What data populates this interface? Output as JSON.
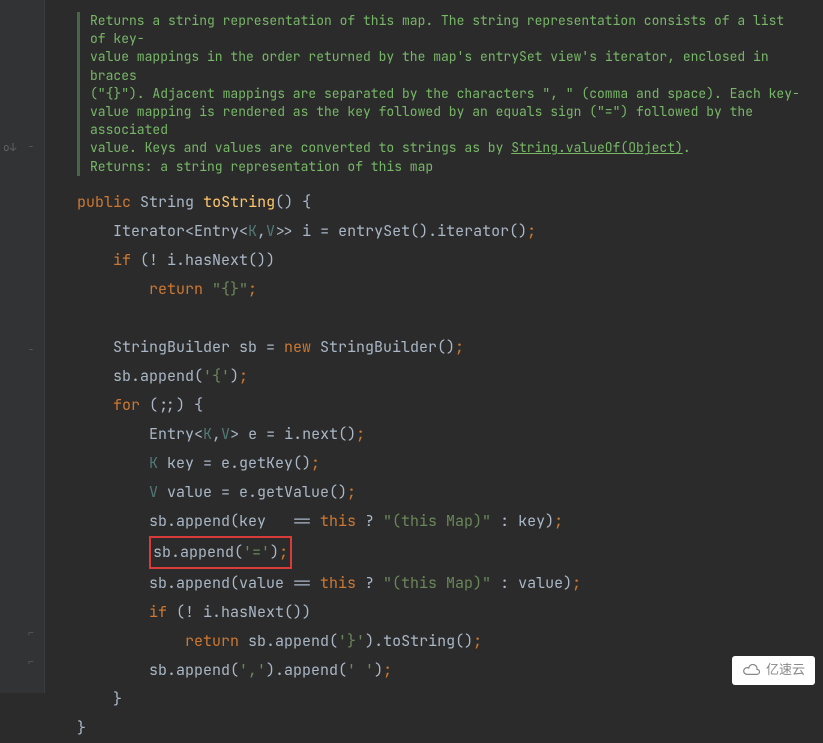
{
  "javadoc": {
    "description_line1": "Returns a string representation of this map. The string representation consists of a list of key-",
    "description_line2_pre": "value mappings in the order returned by the map's ",
    "description_line2_code": "entrySet",
    "description_line2_post": " view's iterator, enclosed in braces",
    "description_line3": "(\"{}\"). Adjacent mappings are separated by the characters \",  \" (comma and space). Each key-",
    "description_line4": "value mapping is rendered as the key followed by an equals sign (\"=\") followed by the associated",
    "description_line5_pre": "value. Keys and values are converted to strings as by ",
    "description_line5_ref": "String.valueOf(Object)",
    "description_line5_post": ".",
    "returns_label": "Returns:",
    "returns_text": " a string representation of this map"
  },
  "code": {
    "kw_public": "public",
    "type_string": "String",
    "method_tostring": "toString",
    "sig_end": "() {",
    "line2_pre": "    Iterator<Entry<",
    "tp_k": "K",
    "comma": ",",
    "tp_v": "V",
    "line2_post": ">> i = entrySet().iterator()",
    "semi": ";",
    "line3_if": "if",
    "line3_cond": " (! i.hasNext())",
    "line4_return": "return",
    "line4_str": " \"{}\"",
    "line6_pre": "    StringBuilder sb = ",
    "kw_new": "new",
    "line6_post": " StringBuilder()",
    "line7_pre": "    sb.append(",
    "line7_char": "'{'",
    "line7_post": ")",
    "line8_for": "for",
    "line8_cond": " (;;) {",
    "line9_pre": "        Entry<",
    "line9_post": "> e = i.next()",
    "line10_pre": "        ",
    "line10_type": "K",
    "line10_post": " key = e.getKey()",
    "line11_type": "V",
    "line11_post": " value = e.getValue()",
    "line12_pre": "        sb.append(key   == ",
    "kw_this": "this",
    "line12_q": " ? ",
    "line12_str": "\"(this Map)\"",
    "line12_post": " : key)",
    "line13_box": "sb.append('=');",
    "line13_box_pre": "sb.append(",
    "line13_box_char": "'='",
    "line13_box_post": ")",
    "line14_pre": "        sb.append(value == ",
    "line14_post": " : value)",
    "line15_if": "if",
    "line15_cond": " (! i.hasNext())",
    "line16_return": "return",
    "line16_pre": " sb.append(",
    "line16_char": "'}'",
    "line16_post": ").toString()",
    "line17_pre": "        sb.append(",
    "line17_char1": "','",
    "line17_mid": ").append(",
    "line17_char2": "' '",
    "line17_post": ")",
    "brace_close": "    }",
    "brace_close2": "}"
  },
  "gutter": {
    "override_icon": "o↓",
    "fold_minus": "−"
  },
  "watermark": {
    "text": "亿速云"
  }
}
